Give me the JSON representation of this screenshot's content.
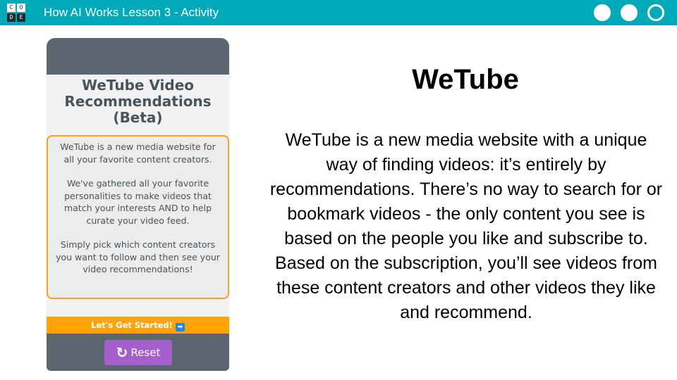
{
  "header": {
    "logo_letters": [
      "C",
      "O",
      "D",
      "E"
    ],
    "title": "How AI Works Lesson 3 - Activity",
    "progress_dots": [
      "filled",
      "filled",
      "current"
    ],
    "bg_color": "#00a9b8"
  },
  "app": {
    "title_line1": "WeTube Video",
    "title_line2": "Recommendations",
    "title_line3": "(Beta)",
    "description": [
      "WeTube is a new media website for all your favorite content creators.",
      "We've gathered all your favorite personalities to make videos that match your interests AND to help curate your video feed.",
      "Simply pick which content creators you want to follow and then see your video recommendations!"
    ],
    "start_button": "Let's Get Started!",
    "start_icon": "arrow-right-icon",
    "reset_button": "Reset",
    "reset_icon": "refresh-icon",
    "colors": {
      "accent_orange": "#ffa400",
      "reset_purple": "#a55fcc",
      "panel_gray": "#5b6670"
    }
  },
  "main": {
    "title": "WeTube",
    "body": " WeTube is a new media website with a unique way of finding videos: it’s entirely by recommendations. There’s no way to search for or bookmark videos - the only content you see is based on the people you like and subscribe to. Based on the subscription, you’ll see videos from these content creators and other videos they like and recommend."
  }
}
